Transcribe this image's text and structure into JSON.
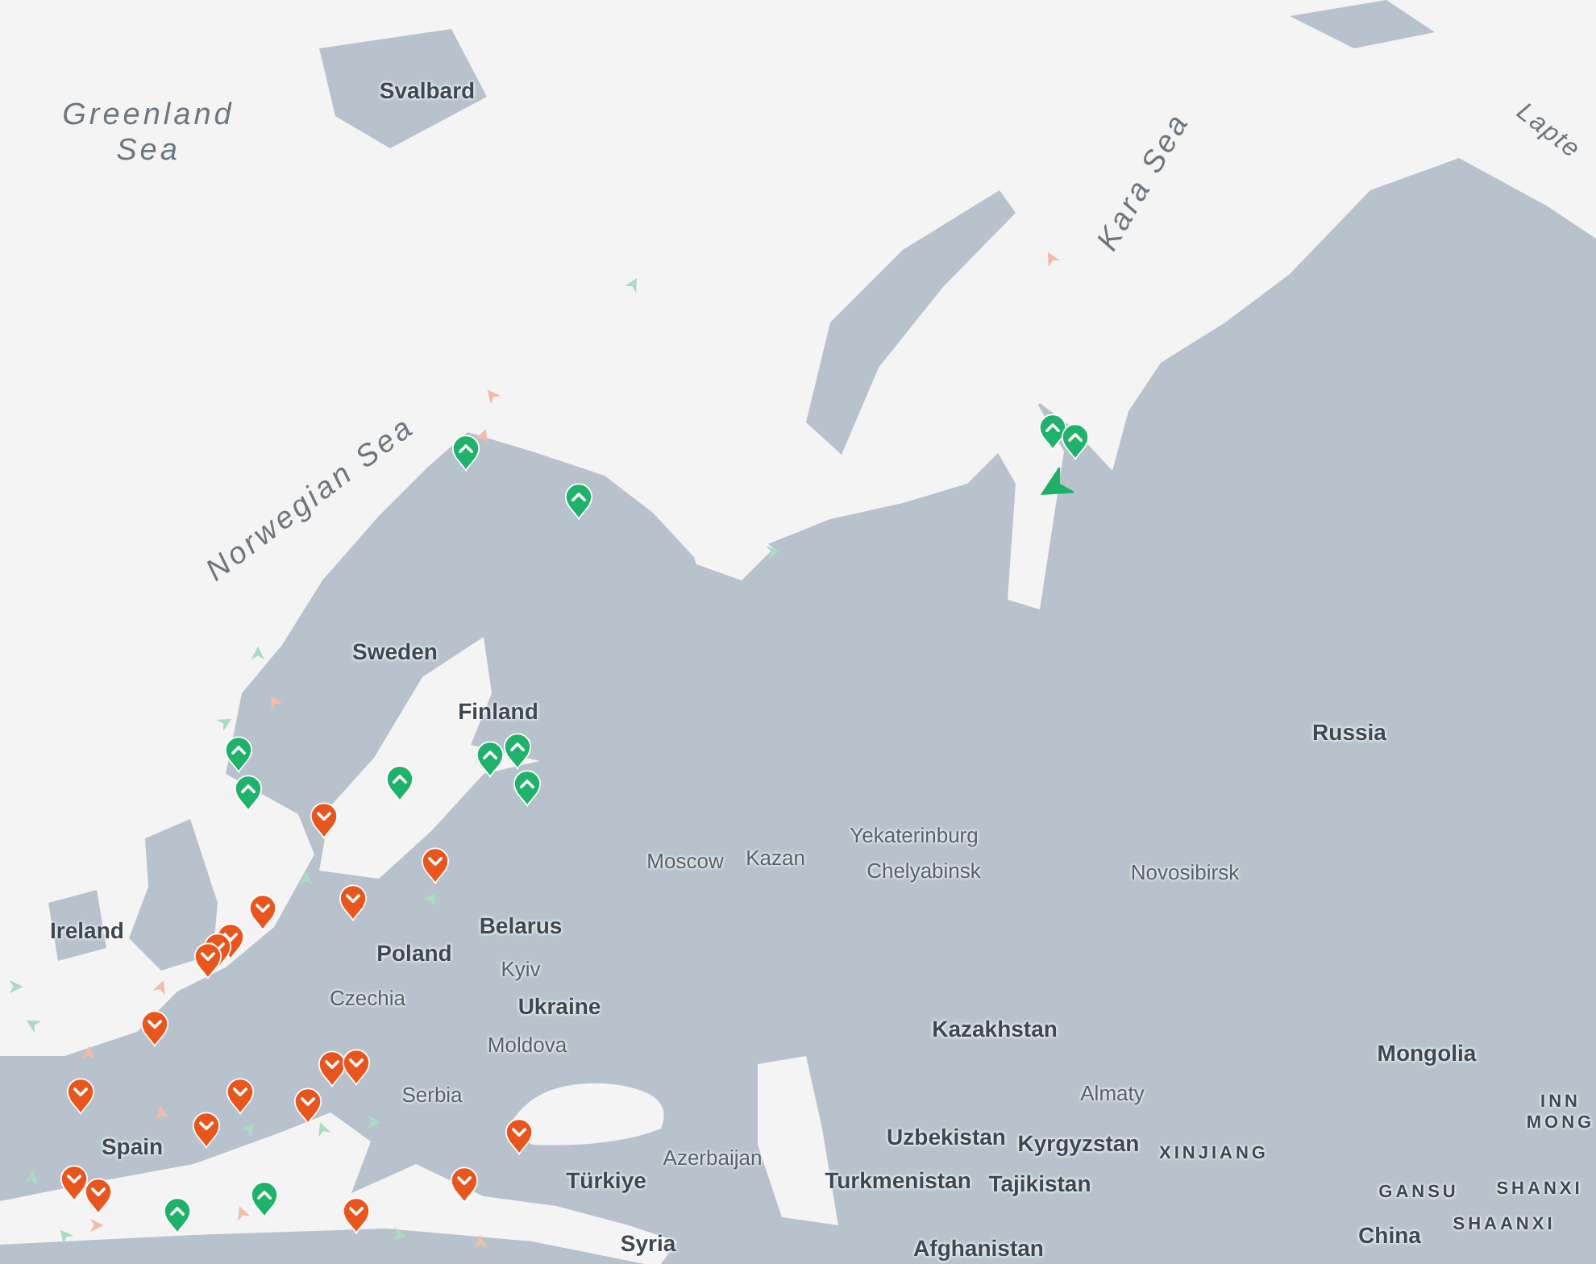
{
  "map": {
    "labels": [
      {
        "text": "Greenland Sea",
        "kind": "sea"
      },
      {
        "text": "Svalbard",
        "kind": "country"
      },
      {
        "text": "Lapte",
        "kind": "sea"
      },
      {
        "text": "Kara Sea",
        "kind": "sea"
      },
      {
        "text": "Norwegian Sea",
        "kind": "sea"
      },
      {
        "text": "Sweden",
        "kind": "country"
      },
      {
        "text": "Finland",
        "kind": "country"
      },
      {
        "text": "Russia",
        "kind": "country"
      },
      {
        "text": "Moscow",
        "kind": "city"
      },
      {
        "text": "Kazan",
        "kind": "city"
      },
      {
        "text": "Yekaterinburg",
        "kind": "city"
      },
      {
        "text": "Chelyabinsk",
        "kind": "city"
      },
      {
        "text": "Novosibirsk",
        "kind": "city"
      },
      {
        "text": "Ireland",
        "kind": "country"
      },
      {
        "text": "Belarus",
        "kind": "country"
      },
      {
        "text": "Poland",
        "kind": "country"
      },
      {
        "text": "Kyiv",
        "kind": "city"
      },
      {
        "text": "Czechia",
        "kind": "city"
      },
      {
        "text": "Ukraine",
        "kind": "country"
      },
      {
        "text": "Moldova",
        "kind": "city"
      },
      {
        "text": "Kazakhstan",
        "kind": "country"
      },
      {
        "text": "Mongolia",
        "kind": "country"
      },
      {
        "text": "Serbia",
        "kind": "city"
      },
      {
        "text": "Almaty",
        "kind": "city"
      },
      {
        "text": "Uzbekistan",
        "kind": "country"
      },
      {
        "text": "Kyrgyzstan",
        "kind": "country"
      },
      {
        "text": "XINJIANG",
        "kind": "region"
      },
      {
        "text": "INN MONG",
        "kind": "region"
      },
      {
        "text": "Spain",
        "kind": "country"
      },
      {
        "text": "Azerbaijan",
        "kind": "city"
      },
      {
        "text": "Türkiye",
        "kind": "country"
      },
      {
        "text": "Turkmenistan",
        "kind": "country"
      },
      {
        "text": "Tajikistan",
        "kind": "country"
      },
      {
        "text": "GANSU",
        "kind": "region"
      },
      {
        "text": "SHANXI",
        "kind": "region"
      },
      {
        "text": "SHAANXI",
        "kind": "region"
      },
      {
        "text": "China",
        "kind": "country"
      },
      {
        "text": "Syria",
        "kind": "country"
      },
      {
        "text": "Afghanistan",
        "kind": "country"
      }
    ],
    "markers": [
      {
        "kind": "up"
      },
      {
        "kind": "up"
      },
      {
        "kind": "up"
      },
      {
        "kind": "up"
      },
      {
        "kind": "up"
      },
      {
        "kind": "up"
      },
      {
        "kind": "up"
      },
      {
        "kind": "up"
      },
      {
        "kind": "up"
      },
      {
        "kind": "up"
      },
      {
        "kind": "up"
      },
      {
        "kind": "up"
      },
      {
        "kind": "down"
      },
      {
        "kind": "down"
      },
      {
        "kind": "down"
      },
      {
        "kind": "down"
      },
      {
        "kind": "down"
      },
      {
        "kind": "down"
      },
      {
        "kind": "down"
      },
      {
        "kind": "down"
      },
      {
        "kind": "down"
      },
      {
        "kind": "down"
      },
      {
        "kind": "down"
      },
      {
        "kind": "down"
      },
      {
        "kind": "down"
      },
      {
        "kind": "down"
      },
      {
        "kind": "down"
      },
      {
        "kind": "down"
      },
      {
        "kind": "down"
      },
      {
        "kind": "down"
      },
      {
        "kind": "down"
      }
    ]
  }
}
